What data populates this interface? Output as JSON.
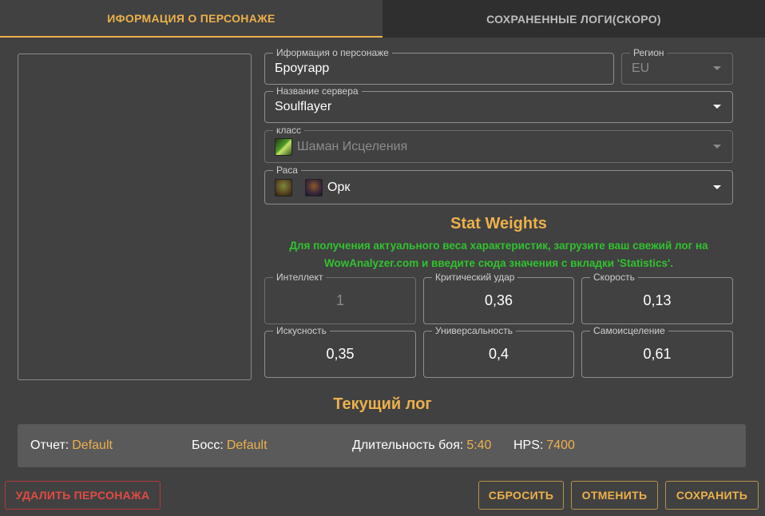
{
  "tabs": {
    "character_info": "ИФОРМАЦИЯ О ПЕРСОНАЖЕ",
    "saved_logs": "СОХРАНЕННЫЕ ЛОГИ(СКОРО)"
  },
  "form": {
    "name": {
      "label": "Иформация о персонаже",
      "value": "Броугарр"
    },
    "region": {
      "label": "Регион",
      "value": "EU"
    },
    "server": {
      "label": "Название сервера",
      "value": "Soulflayer"
    },
    "class": {
      "label": "класс",
      "value": "Шаман Исцеления",
      "icon": "shaman-restoration-icon"
    },
    "race": {
      "label": "Раса",
      "value": "Орк",
      "icons": [
        "orc-male-icon",
        "orc-female-icon"
      ]
    }
  },
  "stat_weights": {
    "title": "Stat Weights",
    "hint_line1": "Для получения актуального веса характеристик, загрузите ваш свежий лог на",
    "hint_line2": "WowAnalyzer.com и введите сюда значения с вкладки 'Statistics'.",
    "stats": [
      {
        "label": "Интеллект",
        "value": "1"
      },
      {
        "label": "Критический удар",
        "value": "0,36"
      },
      {
        "label": "Скорость",
        "value": "0,13"
      },
      {
        "label": "Искусность",
        "value": "0,35"
      },
      {
        "label": "Универсальность",
        "value": "0,4"
      },
      {
        "label": "Самоисцеление",
        "value": "0,61"
      }
    ]
  },
  "current_log": {
    "title": "Текущий лог",
    "report": {
      "label": "Отчет:",
      "value": "Default"
    },
    "boss": {
      "label": "Босс:",
      "value": "Default"
    },
    "duration": {
      "label": "Длительность боя:",
      "value": "5:40"
    },
    "hps": {
      "label": "HPS:",
      "value": "7400"
    }
  },
  "buttons": {
    "delete": "УДАЛИТЬ ПЕРСОНАЖА",
    "reset": "СБРОСИТЬ",
    "cancel": "ОТМЕНИТЬ",
    "save": "СОХРАНИТЬ"
  },
  "colors": {
    "accent": "#ecb14b",
    "hint_green": "#31c22f",
    "danger": "#e24a44",
    "background": "#414141"
  }
}
